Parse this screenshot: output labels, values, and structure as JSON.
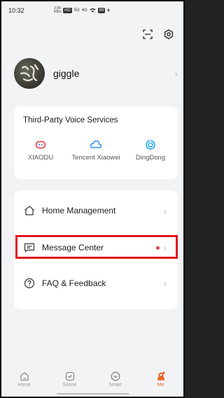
{
  "status_bar": {
    "time": "10:32",
    "icons_text": [
      "2.99 KB/s",
      "HD",
      "5G",
      "4G",
      "wifi",
      "89",
      "charging"
    ]
  },
  "top_actions": [
    {
      "name": "scan-icon"
    },
    {
      "name": "settings-icon"
    }
  ],
  "profile": {
    "username": "giggle",
    "chevron": "›"
  },
  "voice_services": {
    "title": "Third-Party Voice Services",
    "items": [
      {
        "label": "XIAODU",
        "icon": "xiaodu-icon",
        "color": "#e5363c"
      },
      {
        "label": "Tencent Xiaowei",
        "icon": "tencent-xiaowei-icon",
        "color": "#2f8ef4"
      },
      {
        "label": "DingDong",
        "icon": "dingdong-icon",
        "color": "#1aa2f0"
      }
    ]
  },
  "menu": {
    "items": [
      {
        "label": "Home Management",
        "icon": "home-icon",
        "chevron": "›"
      },
      {
        "label": "Message Center",
        "icon": "message-icon",
        "chevron": "›",
        "has_unread_dot": true
      },
      {
        "label": "FAQ & Feedback",
        "icon": "help-icon",
        "chevron": "›"
      }
    ]
  },
  "tabbar": {
    "items": [
      {
        "label": "Home",
        "icon": "home-tab-icon",
        "active": false
      },
      {
        "label": "Scene",
        "icon": "scene-tab-icon",
        "active": false
      },
      {
        "label": "Smart",
        "icon": "smart-tab-icon",
        "active": false
      },
      {
        "label": "Me",
        "icon": "me-tab-icon",
        "active": true
      }
    ]
  },
  "colors": {
    "accent": "#e9672c",
    "highlight_border": "#e0141e",
    "background": "#f2f3f5",
    "unread_dot": "#e0474c"
  }
}
